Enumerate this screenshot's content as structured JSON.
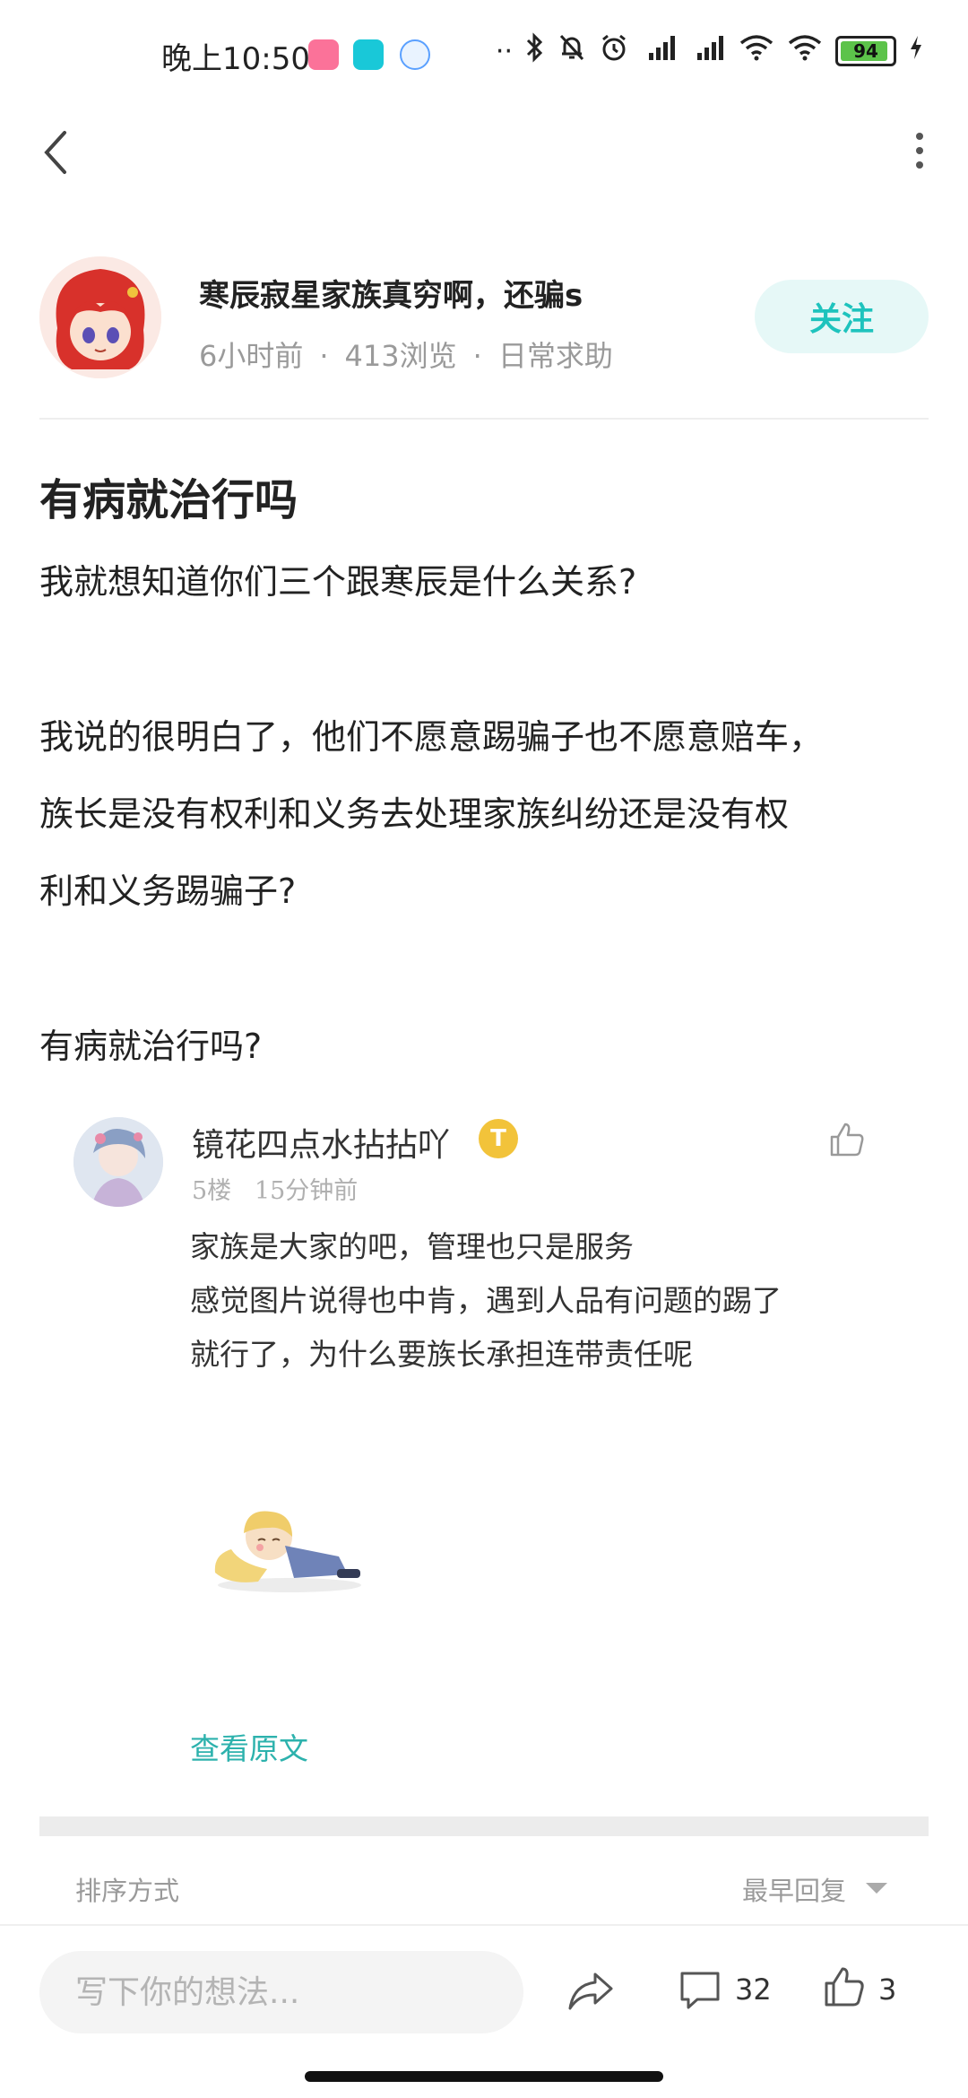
{
  "status_bar": {
    "time": "晚上10:50",
    "battery": "94",
    "apps": [
      "bilibili",
      "Tap"
    ]
  },
  "nav": {
    "back_icon": "chevron-left-icon",
    "more_icon": "more-vertical-icon"
  },
  "author": {
    "name": "寒辰寂星家族真穷啊，还骗s",
    "time_ago": "6小时前",
    "views": "413浏览",
    "category": "日常求助",
    "follow_label": "关注"
  },
  "post": {
    "title": "有病就治行吗",
    "paragraphs": [
      "我就想知道你们三个跟寒辰是什么关系?",
      "我说的很明白了，他们不愿意踢骗子也不愿意赔车，",
      "族长是没有权利和义务去处理家族纠纷还是没有权",
      "利和义务踢骗子?",
      "有病就治行吗?"
    ]
  },
  "quoted_reply": {
    "username": "镜花四点水拈拈吖",
    "badge": "T",
    "floor": "5楼",
    "time_ago": "15分钟前",
    "lines": [
      "家族是大家的吧，管理也只是服务",
      "感觉图片说得也中肯，遇到人品有问题的踢了",
      "就行了，为什么要族长承担连带责任呢"
    ],
    "view_original": "查看原文"
  },
  "sort": {
    "label": "排序方式",
    "value": "最早回复"
  },
  "bottom_bar": {
    "input_placeholder": "写下你的想法...",
    "comment_count": "32",
    "like_count": "3"
  },
  "colors": {
    "accent": "#1ec3bd",
    "follow_bg": "#e6f8f7",
    "battery": "#5cc34a"
  }
}
